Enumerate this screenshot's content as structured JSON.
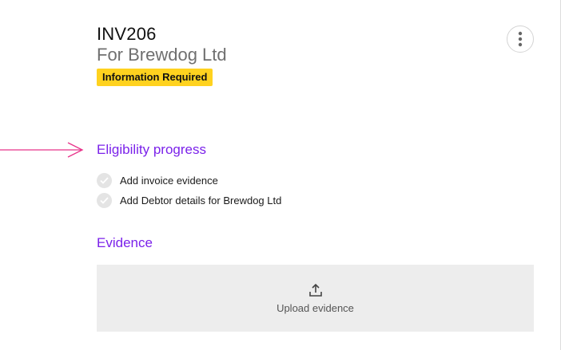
{
  "invoice": {
    "id": "INV206",
    "subtitle": "For Brewdog Ltd",
    "status_badge": "Information Required"
  },
  "eligibility": {
    "title": "Eligibility progress",
    "items": [
      {
        "label": "Add invoice evidence",
        "icon": "check-icon"
      },
      {
        "label": "Add Debtor details for Brewdog Ltd",
        "icon": "check-icon"
      }
    ]
  },
  "evidence": {
    "title": "Evidence",
    "upload_label": "Upload evidence",
    "upload_icon": "upload-icon"
  },
  "colors": {
    "accent": "#7b22ea",
    "badge": "#ffd21f",
    "arrow": "#e8338a"
  }
}
